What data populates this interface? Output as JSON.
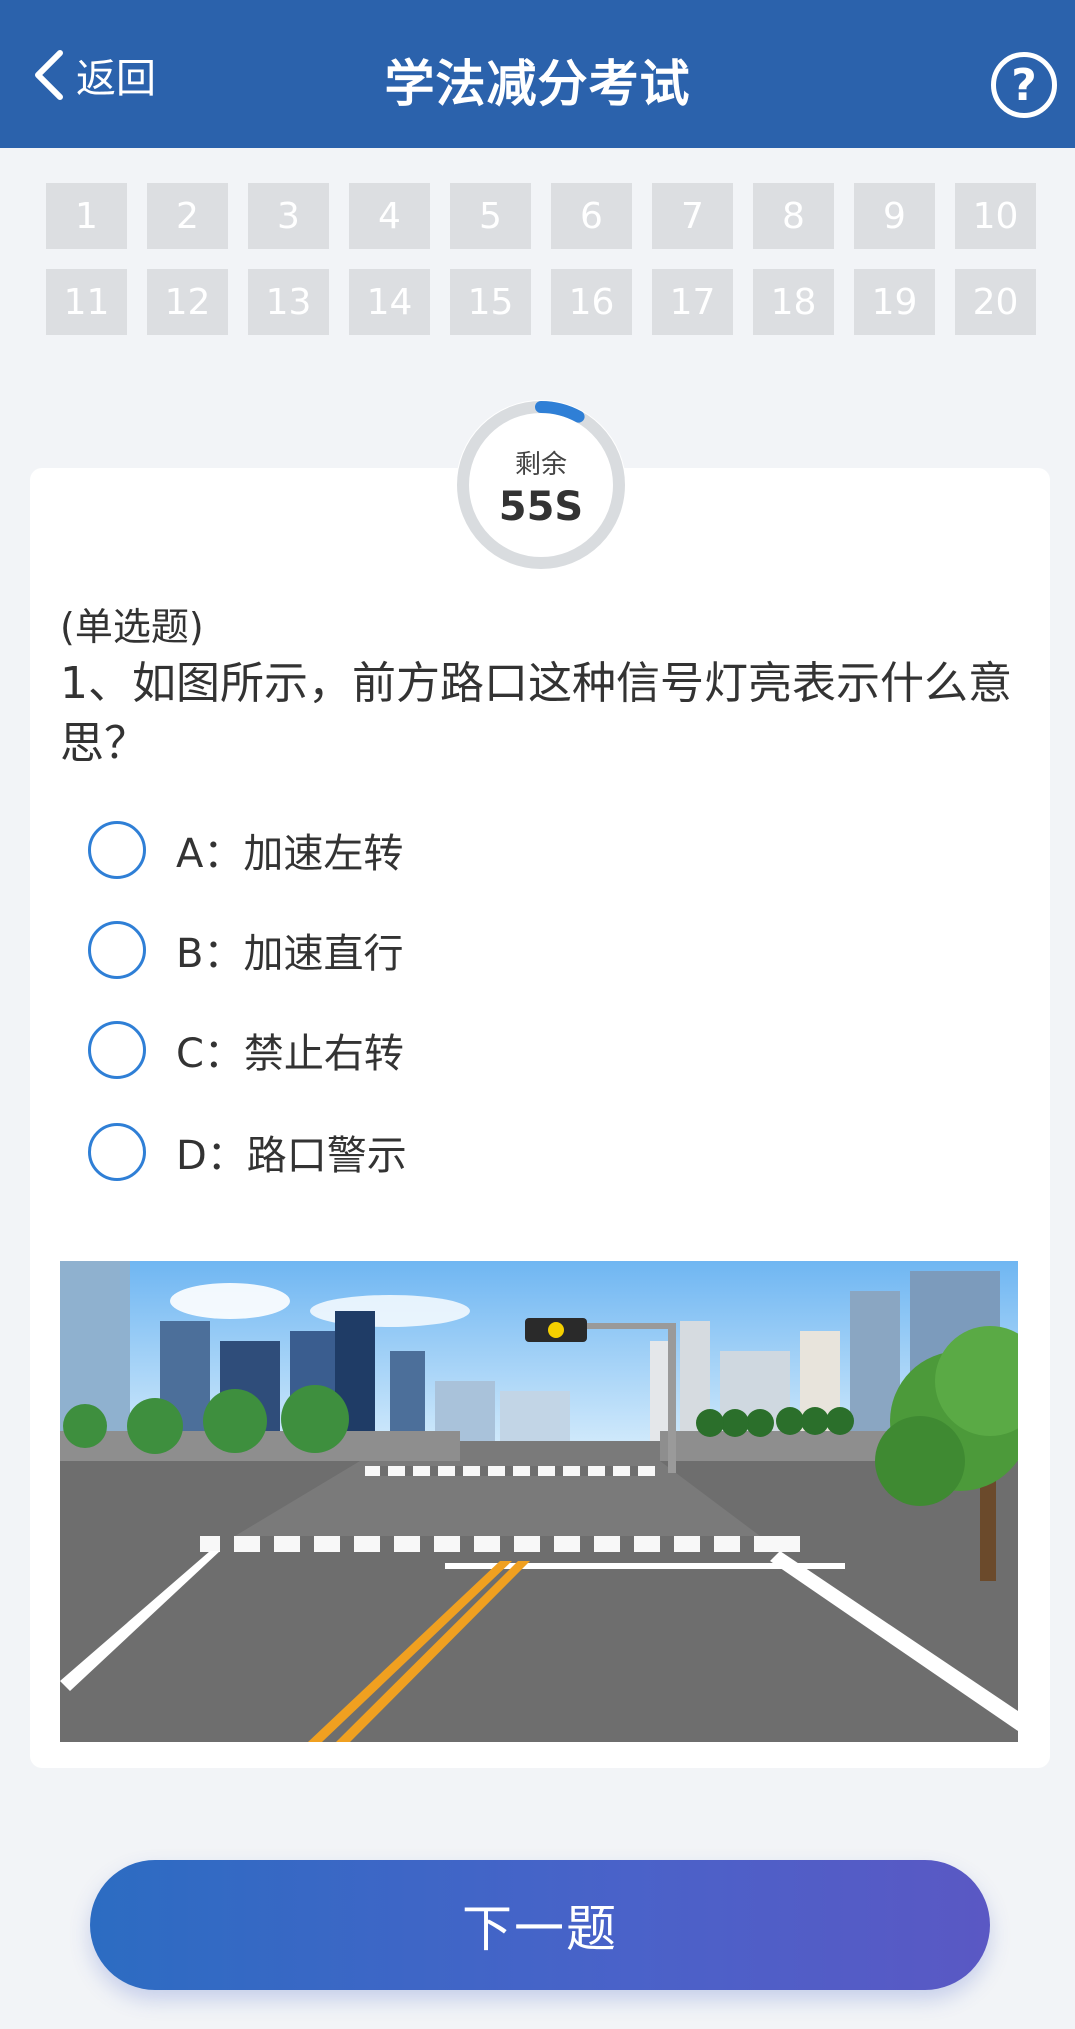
{
  "header": {
    "back_label": "返回",
    "title": "学法减分考试",
    "help_symbol": "?"
  },
  "question_numbers": [
    "1",
    "2",
    "3",
    "4",
    "5",
    "6",
    "7",
    "8",
    "9",
    "10",
    "11",
    "12",
    "13",
    "14",
    "15",
    "16",
    "17",
    "18",
    "19",
    "20"
  ],
  "timer": {
    "label": "剩余",
    "value": "55S",
    "progress_fraction": 0.08,
    "accent_color": "#2f7fd6"
  },
  "question": {
    "type": "(单选题)",
    "text": "1、如图所示，前方路口这种信号灯亮表示什么意思？",
    "options": [
      {
        "label": "A：加速左转"
      },
      {
        "label": "B：加速直行"
      },
      {
        "label": "C：禁止右转"
      },
      {
        "label": "D：路口警示"
      }
    ],
    "image": "intersection-with-flashing-yellow-signal"
  },
  "footer": {
    "next_label": "下一题"
  },
  "colors": {
    "header_bg": "#2b62ac",
    "number_tile_bg": "#dcdee1",
    "radio_border": "#2f7fd6"
  }
}
